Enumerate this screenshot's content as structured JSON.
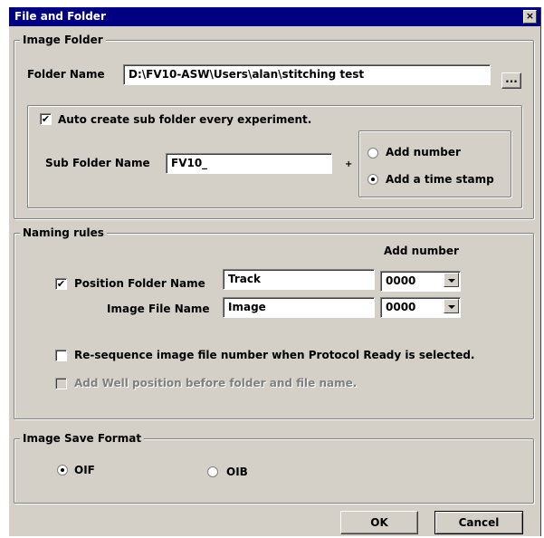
{
  "window": {
    "title": "File and Folder",
    "close_glyph": "×"
  },
  "image_folder": {
    "legend": "Image Folder",
    "folder_name_label": "Folder Name",
    "folder_name_value": "D:\\FV10-ASW\\Users\\alan\\stitching test",
    "browse_label": "...",
    "auto_create_label": "Auto create sub folder every experiment.",
    "auto_create_checked": true,
    "sub_folder_label": "Sub Folder Name",
    "sub_folder_value": "FV10_",
    "plus": "+",
    "add_number_label": "Add number",
    "add_timestamp_label": "Add a time stamp",
    "selected_option": "Add a time stamp"
  },
  "naming_rules": {
    "legend": "Naming rules",
    "add_number_header": "Add number",
    "position_folder_label": "Position Folder Name",
    "position_folder_checked": true,
    "position_folder_value": "Track",
    "position_folder_number": "0000",
    "image_file_label": "Image File Name",
    "image_file_value": "Image",
    "image_file_number": "0000",
    "resequence_label": "Re-sequence image file number when Protocol Ready is selected.",
    "resequence_checked": false,
    "well_position_label": "Add Well position before folder and file name.",
    "well_position_checked": false,
    "well_position_enabled": false
  },
  "image_save_format": {
    "legend": "Image Save Format",
    "oif_label": "OIF",
    "oib_label": "OIB",
    "selected": "OIF"
  },
  "buttons": {
    "ok": "OK",
    "cancel": "Cancel"
  }
}
